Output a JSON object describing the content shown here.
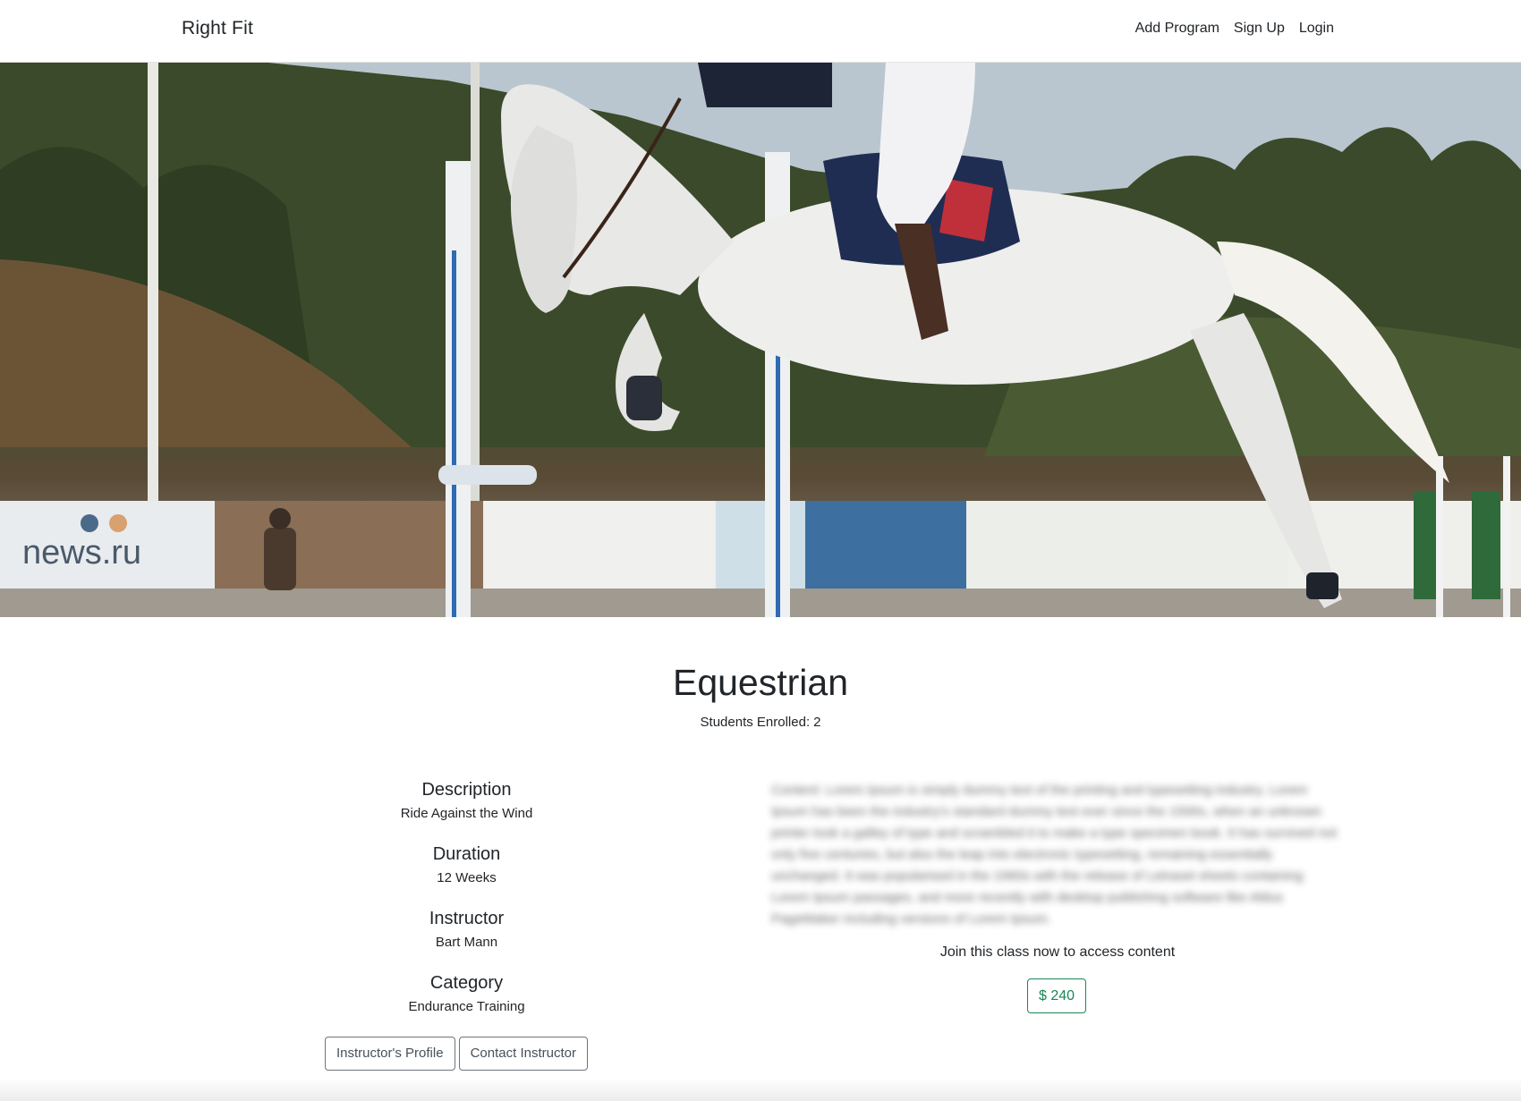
{
  "navbar": {
    "brand": "Right Fit",
    "links": [
      "Add Program",
      "Sign Up",
      "Login"
    ]
  },
  "hero": {
    "image_alt": "Rider on white horse jumping over an obstacle",
    "banner_text": "news.ru"
  },
  "program": {
    "title": "Equestrian",
    "enrolled_label": "Students Enrolled:",
    "enrolled_count": "2"
  },
  "details": [
    {
      "heading": "Description",
      "value": "Ride Against the Wind"
    },
    {
      "heading": "Duration",
      "value": "12 Weeks"
    },
    {
      "heading": "Instructor",
      "value": "Bart Mann"
    },
    {
      "heading": "Category",
      "value": "Endurance Training"
    }
  ],
  "buttons": {
    "profile": "Instructor's Profile",
    "contact": "Contact Instructor"
  },
  "content": {
    "blurred_text": "Content: Lorem Ipsum is simply dummy text of the printing and typesetting industry. Lorem Ipsum has been the industry's standard dummy text ever since the 1500s, when an unknown printer took a galley of type and scrambled it to make a type specimen book. It has survived not only five centuries, but also the leap into electronic typesetting, remaining essentially unchanged. It was popularised in the 1960s with the release of Letraset sheets containing Lorem Ipsum passages, and more recently with desktop publishing software like Aldus PageMaker including versions of Lorem Ipsum.",
    "join_text": "Join this class now to access content",
    "price": "$ 240"
  },
  "colors": {
    "price_accent": "#198754",
    "button_border": "#6c757d"
  }
}
